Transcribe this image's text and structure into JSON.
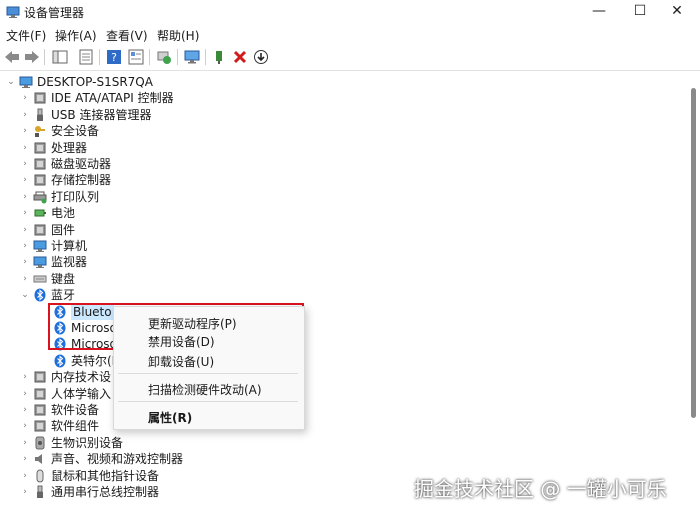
{
  "window": {
    "title": "设备管理器",
    "buttons": {
      "minimize": "—",
      "maximize": "☐",
      "close": "✕"
    }
  },
  "menu": [
    "文件(F)",
    "操作(A)",
    "查看(V)",
    "帮助(H)"
  ],
  "tree": {
    "root": "DESKTOP-S1SR7QA",
    "categories": [
      {
        "label": "IDE ATA/ATAPI 控制器",
        "icon": "ide-controller-icon"
      },
      {
        "label": "USB 连接器管理器",
        "icon": "usb-icon"
      },
      {
        "label": "安全设备",
        "icon": "security-device-icon"
      },
      {
        "label": "处理器",
        "icon": "processor-icon"
      },
      {
        "label": "磁盘驱动器",
        "icon": "disk-drive-icon"
      },
      {
        "label": "存储控制器",
        "icon": "storage-controller-icon"
      },
      {
        "label": "打印队列",
        "icon": "printer-icon"
      },
      {
        "label": "电池",
        "icon": "battery-icon"
      },
      {
        "label": "固件",
        "icon": "firmware-icon"
      },
      {
        "label": "计算机",
        "icon": "computer-icon"
      },
      {
        "label": "监视器",
        "icon": "monitor-icon"
      },
      {
        "label": "键盘",
        "icon": "keyboard-icon"
      },
      {
        "label": "蓝牙",
        "icon": "bluetooth-icon"
      }
    ],
    "bluetooth_children": [
      "Blueto",
      "Microso",
      "Microso",
      "英特尔(R"
    ],
    "categories_after": [
      {
        "label": "内存技术设",
        "icon": "memory-tech-icon"
      },
      {
        "label": "人体学输入",
        "icon": "hid-icon"
      },
      {
        "label": "软件设备",
        "icon": "software-device-icon"
      },
      {
        "label": "软件组件",
        "icon": "software-component-icon"
      },
      {
        "label": "生物识别设备",
        "icon": "biometric-icon"
      },
      {
        "label": "声音、视频和游戏控制器",
        "icon": "sound-icon"
      },
      {
        "label": "鼠标和其他指针设备",
        "icon": "mouse-icon"
      },
      {
        "label": "通用串行总线控制器",
        "icon": "usb-controller-icon"
      }
    ]
  },
  "context_menu": {
    "update_driver": "更新驱动程序(P)",
    "disable_device": "禁用设备(D)",
    "uninstall_device": "卸载设备(U)",
    "scan_hardware": "扫描检测硬件改动(A)",
    "properties": "属性(R)"
  },
  "watermark": "掘金技术社区 @ 一罐小可乐",
  "colors": {
    "highlight_border": "#d9141f",
    "bluetooth": "#1e6fd9",
    "selection": "#cce8ff"
  }
}
